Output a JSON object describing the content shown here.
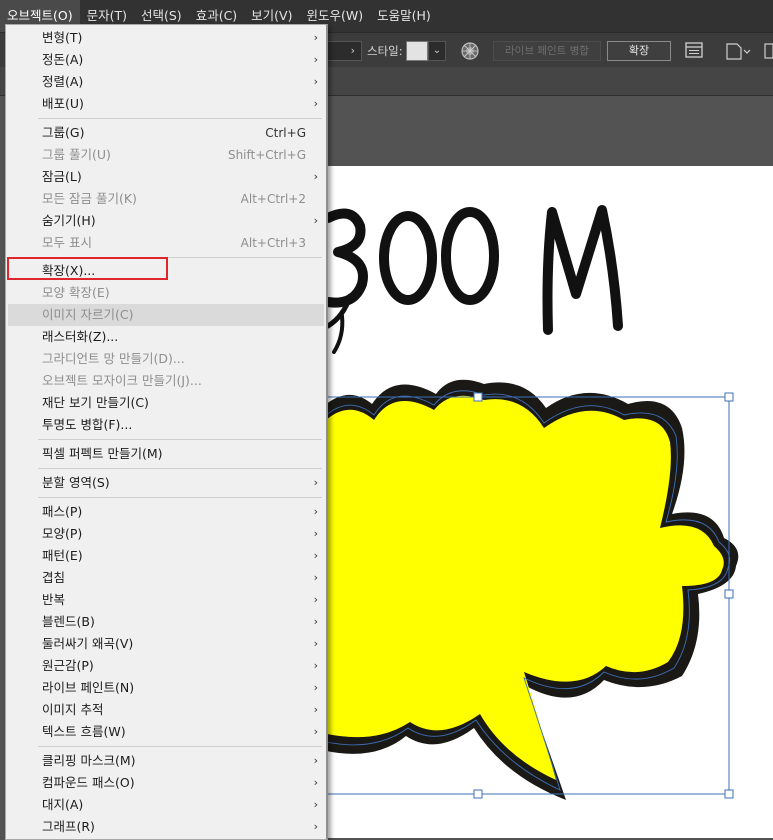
{
  "menubar": {
    "items": [
      {
        "label": "오브젝트(O)",
        "active": true
      },
      {
        "label": "문자(T)"
      },
      {
        "label": "선택(S)"
      },
      {
        "label": "효과(C)"
      },
      {
        "label": "보기(V)"
      },
      {
        "label": "윈도우(W)"
      },
      {
        "label": "도움말(H)"
      }
    ]
  },
  "controlbar": {
    "style_label": "스타일:",
    "live_paint_merge": "라이브 페인트 병합",
    "expand_button": "확장"
  },
  "artboard": {
    "title_text": "BOOM",
    "bubble_fill": "#ffff00",
    "outline_color": "#1b1916",
    "selection_color": "#3d6fb5"
  },
  "menu": {
    "items": [
      {
        "label": "변형(T)",
        "submenu": true
      },
      {
        "label": "정돈(A)",
        "submenu": true
      },
      {
        "label": "정렬(A)",
        "submenu": true
      },
      {
        "label": "배포(U)",
        "submenu": true
      },
      {
        "label": "그룹(G)",
        "shortcut": "Ctrl+G"
      },
      {
        "label": "그룹 풀기(U)",
        "shortcut": "Shift+Ctrl+G",
        "disabled": true
      },
      {
        "label": "잠금(L)",
        "submenu": true
      },
      {
        "label": "모든 잠금 풀기(K)",
        "shortcut": "Alt+Ctrl+2",
        "disabled": true
      },
      {
        "label": "숨기기(H)",
        "submenu": true
      },
      {
        "label": "모두 표시",
        "shortcut": "Alt+Ctrl+3",
        "disabled": true
      },
      {
        "label": "확장(X)..."
      },
      {
        "label": "모양 확장(E)",
        "disabled": true
      },
      {
        "label": "이미지 자르기(C)",
        "disabled": true,
        "highlighted": true
      },
      {
        "label": "래스터화(Z)..."
      },
      {
        "label": "그라디언트 망 만들기(D)...",
        "disabled": true
      },
      {
        "label": "오브젝트 모자이크 만들기(J)...",
        "disabled": true
      },
      {
        "label": "재단 보기 만들기(C)"
      },
      {
        "label": "투명도 병합(F)..."
      },
      {
        "label": "픽셀 퍼펙트 만들기(M)"
      },
      {
        "label": "분할 영역(S)",
        "submenu": true
      },
      {
        "label": "패스(P)",
        "submenu": true
      },
      {
        "label": "모양(P)",
        "submenu": true
      },
      {
        "label": "패턴(E)",
        "submenu": true
      },
      {
        "label": "겹침",
        "submenu": true
      },
      {
        "label": "반복",
        "submenu": true
      },
      {
        "label": "블렌드(B)",
        "submenu": true
      },
      {
        "label": "둘러싸기 왜곡(V)",
        "submenu": true
      },
      {
        "label": "원근감(P)",
        "submenu": true
      },
      {
        "label": "라이브 페인트(N)",
        "submenu": true
      },
      {
        "label": "이미지 추적",
        "submenu": true
      },
      {
        "label": "텍스트 흐름(W)",
        "submenu": true
      },
      {
        "label": "클리핑 마스크(M)",
        "submenu": true
      },
      {
        "label": "컴파운드 패스(O)",
        "submenu": true
      },
      {
        "label": "대지(A)",
        "submenu": true
      },
      {
        "label": "그래프(R)",
        "submenu": true
      }
    ]
  }
}
